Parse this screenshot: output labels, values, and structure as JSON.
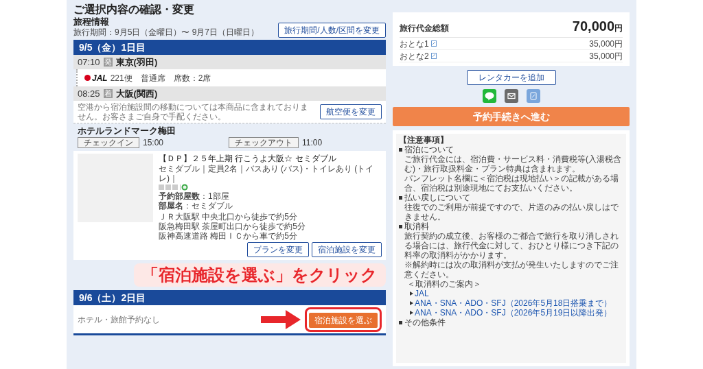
{
  "title": "ご選択内容の確認・変更",
  "itinerary": {
    "heading": "旅程情報",
    "period": "旅行期間：9月5日（金曜日）〜 9月7日（日曜日）",
    "change_button": "旅行期間/人数/区間を変更"
  },
  "days": [
    {
      "header": "9/5（金）1日目",
      "kind": "trip",
      "departure": {
        "time": "07:10",
        "badge": "発",
        "place": "東京(羽田)"
      },
      "flight": {
        "airline": "JAL",
        "detail": "221便　普通席　席数：2席"
      },
      "arrival": {
        "time": "08:25",
        "badge": "着",
        "place": "大阪(関西)"
      },
      "transfer_note": "空港から宿泊施設間の移動については本商品に含まれておりません。お客さまご自身で手配ください。",
      "flight_button": "航空便を変更",
      "hotel": {
        "name": "ホテルランドマーク梅田",
        "checkin_label": "チェックイン",
        "checkin": "15:00",
        "checkout_label": "チェックアウト",
        "checkout": "11:00",
        "plan": "【ＤＰ】２５年上期 行こうよ大阪☆ セミダブル",
        "room": "セミダブル｜定員2名｜バスあり (バス)・トイレあり (トイレ)｜",
        "rooms": "**予約部屋数**：1部屋",
        "room_name": "**部屋名**：セミダブル",
        "access": [
          "ＪＲ大阪駅 中央北口から徒歩で約5分",
          "阪急梅田駅 茶屋町出口から徒歩で約5分",
          "阪神高速道路 梅田ＩＣから車で約5分"
        ],
        "buttons": [
          "プランを変更",
          "宿泊施設を変更"
        ]
      }
    },
    {
      "header": "9/6（土）2日目",
      "kind": "empty",
      "no_hotel": "ホテル・旅館予約なし",
      "select_button": "宿泊施設を選ぶ",
      "highlighted": true
    }
  ],
  "summary": {
    "label": "旅行代金総額",
    "total": "70,000",
    "unit": "円",
    "rows": [
      {
        "label": "おとな1",
        "price": "35,000円"
      },
      {
        "label": "おとな2",
        "price": "35,000円"
      }
    ]
  },
  "rental_button": "レンタカーを追加",
  "proceed_button": "予約手続きへ進む",
  "notes": {
    "heading": "【注意事項】",
    "sections": [
      {
        "title": "宿泊について",
        "lines": [
          "ご旅行代金には、宿泊費・サービス料・消費税等(入湯税含む)・旅行取扱料金・プラン特典は含まれます。",
          "パンフレット名欄に＜宿泊税は現地払い＞の記載がある場合、宿泊税は別途現地にてお支払いください。"
        ]
      },
      {
        "title": "払い戻しについて",
        "lines": [
          "往復でのご利用が前提ですので、片道のみの払い戻しはできません。"
        ]
      },
      {
        "title": "取消料",
        "lines": [
          "旅行契約の成立後、お客様のご都合で旅行を取り消しされる場合には、旅行代金に対して、おひとり様につき下記の料率の取消料がかかります。"
        ]
      }
    ],
    "cancel_note": "※解約時には次の取消料が支払が発生いたしますのでご注意ください。",
    "cancel_guide": "＜取消料のご案内＞",
    "links": [
      "JAL",
      "ANA・SNA・ADO・SFJ（2026年5月18日搭乗まで）",
      "ANA・SNA・ADO・SFJ（2026年5月19日以降出発）"
    ],
    "other_title": "その他条件"
  },
  "callout": "「宿泊施設を選ぶ」をクリック"
}
